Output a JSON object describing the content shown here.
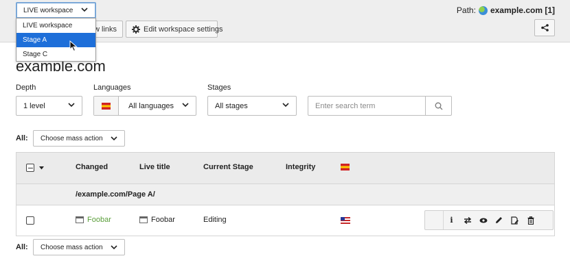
{
  "workspace": {
    "current": "LIVE workspace",
    "options": [
      "LIVE workspace",
      "Stage A",
      "Stage C"
    ],
    "highlighted": "Stage A"
  },
  "toolbar": {
    "view_links_label": "w links",
    "edit_workspace_label": "Edit workspace settings"
  },
  "path": {
    "label": "Path:",
    "site": "example.com [1]"
  },
  "page": {
    "title": "example.com"
  },
  "filters": {
    "depth_label": "Depth",
    "depth_value": "1 level",
    "languages_label": "Languages",
    "languages_value": "All languages",
    "stages_label": "Stages",
    "stages_value": "All stages",
    "search_placeholder": "Enter search term"
  },
  "mass_action": {
    "all_label": "All:",
    "choose_label": "Choose mass action"
  },
  "table": {
    "columns": [
      "Changed",
      "Live title",
      "Current Stage",
      "Integrity"
    ],
    "group_path": "/example.com/Page A/",
    "rows": [
      {
        "changed": "Foobar",
        "live_title": "Foobar",
        "stage": "Editing"
      }
    ],
    "row_actions": [
      "info-icon",
      "swap-icon",
      "view-icon",
      "edit-icon",
      "edit-page-icon",
      "delete-icon"
    ]
  },
  "colors": {
    "accent": "#1e6fd9",
    "changed_text": "#5a9e3a",
    "header_bg": "#ebebeb"
  }
}
